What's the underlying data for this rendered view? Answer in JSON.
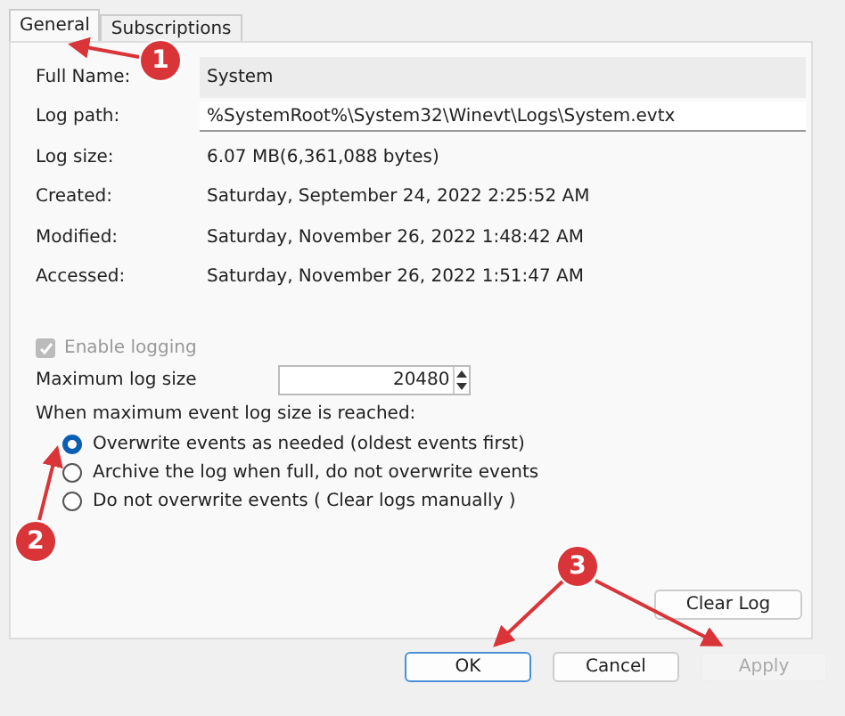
{
  "tabs": [
    {
      "label": "General",
      "selected": true
    },
    {
      "label": "Subscriptions",
      "selected": false
    }
  ],
  "properties": [
    {
      "label": "Full Name:",
      "value": "System",
      "kind": "readonly"
    },
    {
      "label": "Log path:",
      "value": "%SystemRoot%\\System32\\Winevt\\Logs\\System.evtx",
      "kind": "field"
    },
    {
      "label": "Log size:",
      "value": "6.07 MB(6,361,088 bytes)",
      "kind": "text"
    },
    {
      "label": "Created:",
      "value": "Saturday, September 24, 2022 2:25:52 AM",
      "kind": "text"
    },
    {
      "label": "Modified:",
      "value": "Saturday, November 26, 2022 1:48:42 AM",
      "kind": "text"
    },
    {
      "label": "Accessed:",
      "value": "Saturday, November 26, 2022 1:51:47 AM",
      "kind": "text"
    }
  ],
  "enable_logging": {
    "label": "Enable logging",
    "checked": true,
    "disabled": true
  },
  "max_log_size": {
    "label": "Maximum log size",
    "value": "20480"
  },
  "policy_heading": "When maximum event log size is reached:",
  "policy_options": [
    {
      "label": "Overwrite events as needed (oldest events first)",
      "selected": true
    },
    {
      "label": "Archive the log when full, do not overwrite events",
      "selected": false
    },
    {
      "label": "Do not overwrite events ( Clear logs manually )",
      "selected": false
    }
  ],
  "clear_log_button": "Clear Log",
  "buttons": [
    {
      "label": "OK",
      "disabled": false,
      "default": true
    },
    {
      "label": "Cancel",
      "disabled": false,
      "default": false
    },
    {
      "label": "Apply",
      "disabled": true,
      "default": false
    }
  ],
  "annotations": [
    {
      "number": "1"
    },
    {
      "number": "2"
    },
    {
      "number": "3"
    }
  ]
}
